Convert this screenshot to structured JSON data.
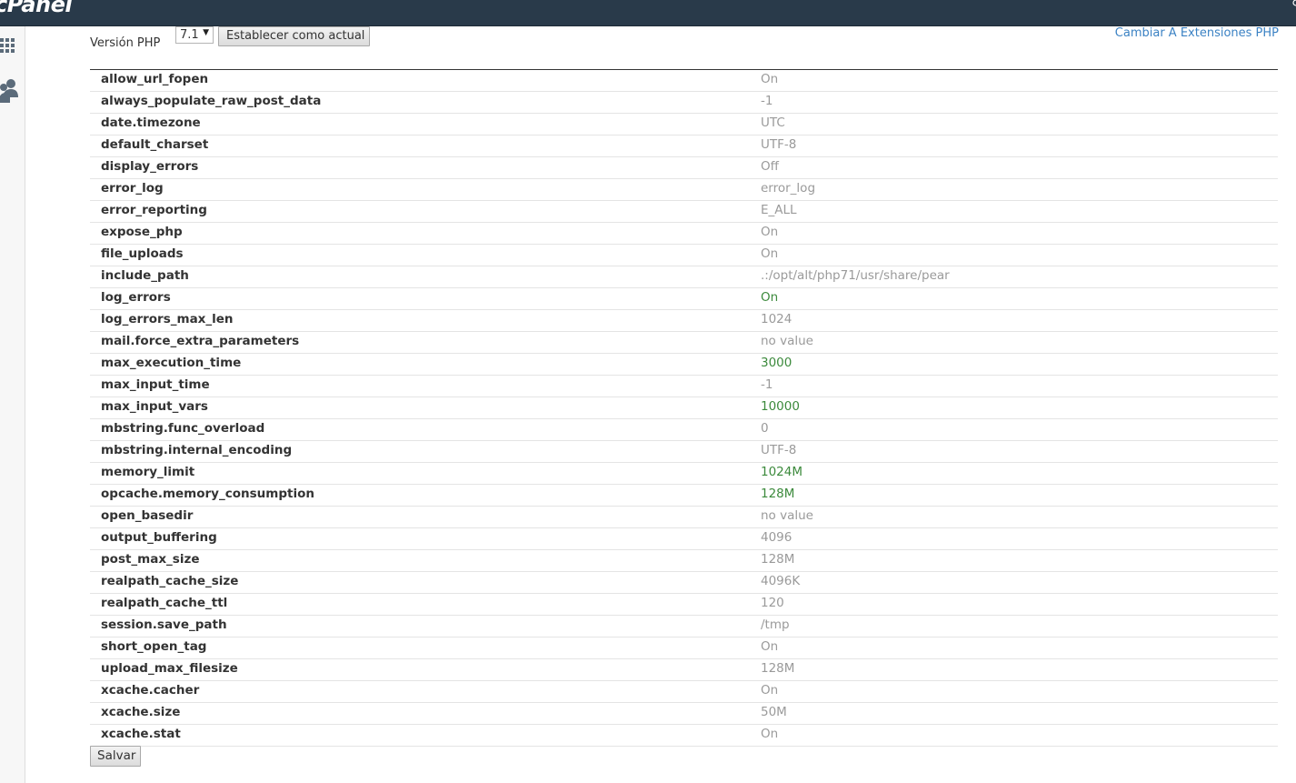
{
  "app": {
    "logo": "cPanel"
  },
  "header": {
    "version_label": "Versión PHP",
    "version_value": "7.1",
    "set_current_label": "Establecer como actual",
    "extensions_link": "Cambiar A Extensiones PHP"
  },
  "sidebar": {
    "items": [
      {
        "icon": "grid-icon"
      },
      {
        "icon": "users-icon"
      }
    ]
  },
  "colors": {
    "topbar": "#293a4a",
    "default_value": "#9a9a9a",
    "modified_value": "#3c8a3c",
    "link": "#3b82c4"
  },
  "options": [
    {
      "name": "allow_url_fopen",
      "value": "On",
      "modified": false
    },
    {
      "name": "always_populate_raw_post_data",
      "value": "-1",
      "modified": false
    },
    {
      "name": "date.timezone",
      "value": "UTC",
      "modified": false
    },
    {
      "name": "default_charset",
      "value": "UTF-8",
      "modified": false
    },
    {
      "name": "display_errors",
      "value": "Off",
      "modified": false
    },
    {
      "name": "error_log",
      "value": "error_log",
      "modified": false
    },
    {
      "name": "error_reporting",
      "value": "E_ALL",
      "modified": false
    },
    {
      "name": "expose_php",
      "value": "On",
      "modified": false
    },
    {
      "name": "file_uploads",
      "value": "On",
      "modified": false
    },
    {
      "name": "include_path",
      "value": ".:/opt/alt/php71/usr/share/pear",
      "modified": false
    },
    {
      "name": "log_errors",
      "value": "On",
      "modified": true
    },
    {
      "name": "log_errors_max_len",
      "value": "1024",
      "modified": false
    },
    {
      "name": "mail.force_extra_parameters",
      "value": "no value",
      "modified": false
    },
    {
      "name": "max_execution_time",
      "value": "3000",
      "modified": true
    },
    {
      "name": "max_input_time",
      "value": "-1",
      "modified": false
    },
    {
      "name": "max_input_vars",
      "value": "10000",
      "modified": true
    },
    {
      "name": "mbstring.func_overload",
      "value": "0",
      "modified": false
    },
    {
      "name": "mbstring.internal_encoding",
      "value": "UTF-8",
      "modified": false
    },
    {
      "name": "memory_limit",
      "value": "1024M",
      "modified": true
    },
    {
      "name": "opcache.memory_consumption",
      "value": "128M",
      "modified": true
    },
    {
      "name": "open_basedir",
      "value": "no value",
      "modified": false
    },
    {
      "name": "output_buffering",
      "value": "4096",
      "modified": false
    },
    {
      "name": "post_max_size",
      "value": "128M",
      "modified": false
    },
    {
      "name": "realpath_cache_size",
      "value": "4096K",
      "modified": false
    },
    {
      "name": "realpath_cache_ttl",
      "value": "120",
      "modified": false
    },
    {
      "name": "session.save_path",
      "value": "/tmp",
      "modified": false
    },
    {
      "name": "short_open_tag",
      "value": "On",
      "modified": false
    },
    {
      "name": "upload_max_filesize",
      "value": "128M",
      "modified": false
    },
    {
      "name": "xcache.cacher",
      "value": "On",
      "modified": false
    },
    {
      "name": "xcache.size",
      "value": "50M",
      "modified": false
    },
    {
      "name": "xcache.stat",
      "value": "On",
      "modified": false
    }
  ],
  "footer": {
    "save_label": "Salvar"
  }
}
